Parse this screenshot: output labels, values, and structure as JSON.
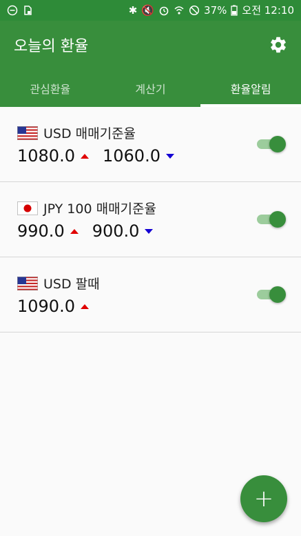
{
  "status_bar": {
    "battery": "37%",
    "time": "오전 12:10"
  },
  "app": {
    "title": "오늘의 환율",
    "settings_icon": "gear-icon"
  },
  "tabs": [
    {
      "label": "관심환율",
      "active": false
    },
    {
      "label": "계산기",
      "active": false
    },
    {
      "label": "환율알림",
      "active": true
    }
  ],
  "alerts": [
    {
      "flag": "us-flag",
      "label": "USD 매매기준율",
      "high": "1080.0",
      "low": "1060.0",
      "enabled": true
    },
    {
      "flag": "jp-flag",
      "label": "JPY 100 매매기준율",
      "high": "990.0",
      "low": "900.0",
      "enabled": true
    },
    {
      "flag": "us-flag",
      "label": "USD 팔때",
      "high": "1090.0",
      "enabled": true
    }
  ],
  "fab": {
    "label": "+"
  },
  "colors": {
    "primary": "#388e3c",
    "up_arrow": "#e00000",
    "down_arrow": "#1400d4"
  }
}
